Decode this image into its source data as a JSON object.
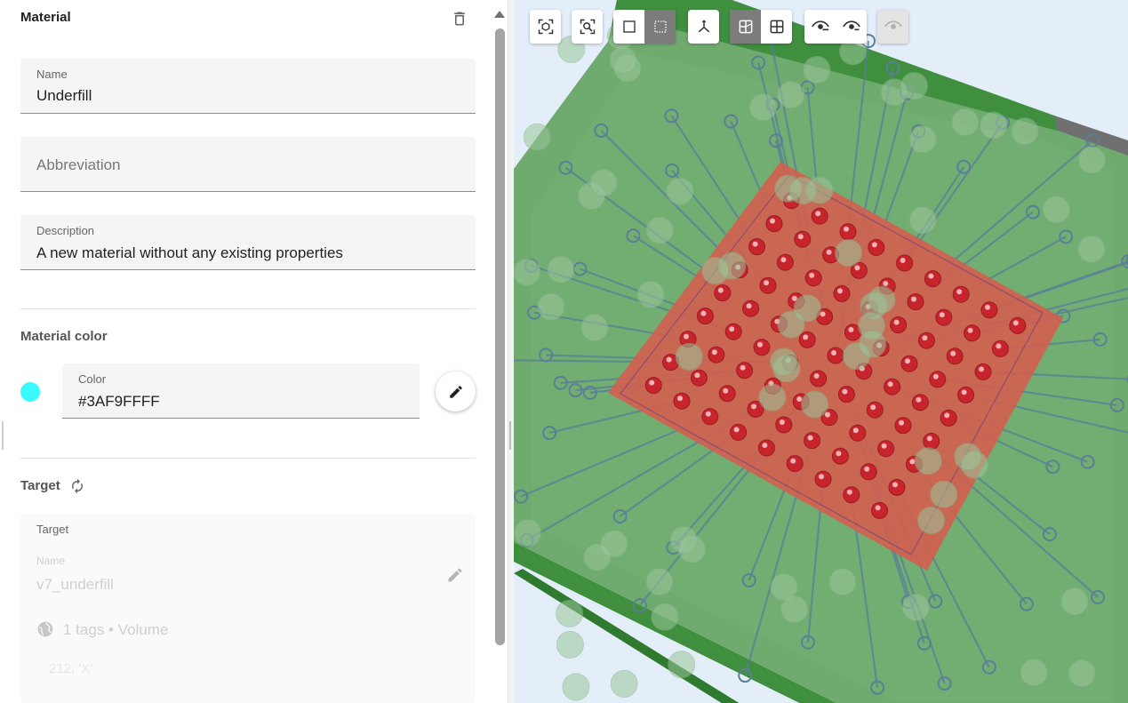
{
  "panel": {
    "title": "Material"
  },
  "fields": {
    "name": {
      "label": "Name",
      "value": "Underfill"
    },
    "abbreviation": {
      "placeholder": "Abbreviation"
    },
    "description": {
      "label": "Description",
      "value": "A new material without any existing properties"
    }
  },
  "material_color": {
    "section_title": "Material color",
    "label": "Color",
    "value": "#3AF9FFFF",
    "swatch_hex": "#3af9ff"
  },
  "target": {
    "section_title": "Target",
    "card_label": "Target",
    "name_label": "Name",
    "name_value": "v7_underfill",
    "tags_text": "1 tags • Volume",
    "id_text": "212, 'X'"
  },
  "toolbar": {
    "buttons": [
      {
        "icon": "fit-selection-icon"
      },
      {
        "icon": "zoom-fit-icon"
      },
      {
        "icon": "select-box-icon"
      },
      {
        "icon": "select-dotted-box-icon",
        "active": true
      },
      {
        "icon": "axes-icon"
      },
      {
        "icon": "section-view-icon",
        "active": true
      },
      {
        "icon": "grid-view-icon"
      },
      {
        "icon": "hide-icon"
      },
      {
        "icon": "show-icon"
      },
      {
        "icon": "eye-disabled-icon",
        "disabled": true
      }
    ]
  },
  "colors": {
    "board_green": "#6aa86a",
    "underfill_red": "#cf5a4a",
    "accent_cyan": "#3af9ff"
  }
}
